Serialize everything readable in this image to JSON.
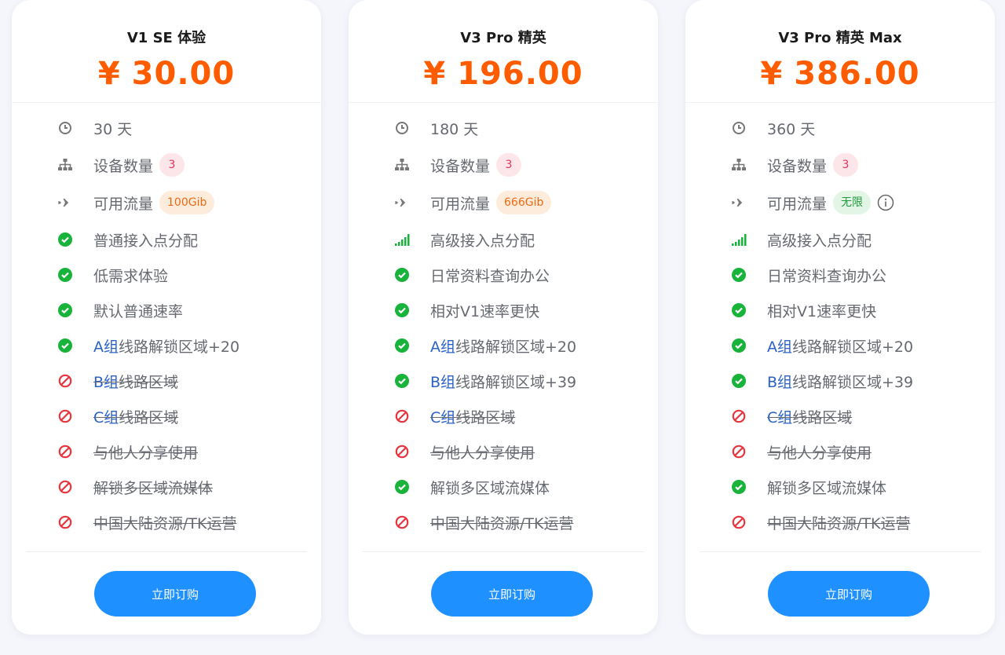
{
  "colors": {
    "accent_price": "#ff5c00",
    "button": "#1e90ff",
    "check_green": "#18b33a",
    "forbid_red": "#e8353d",
    "group_blue": "#2a62c7"
  },
  "plans": [
    {
      "name": "V1 SE 体验",
      "currency": "¥",
      "price": "30.00",
      "duration": "30 天",
      "devices_label": "设备数量",
      "devices_count": "3",
      "traffic_label": "可用流量",
      "traffic_value": "100Gib",
      "features": [
        {
          "icon": "check-circle-icon",
          "text": "普通接入点分配"
        },
        {
          "icon": "check-circle-icon",
          "text": "低需求体验"
        },
        {
          "icon": "check-circle-icon",
          "text": "默认普通速率"
        },
        {
          "icon": "check-circle-icon",
          "group": "A组",
          "text": "线路解锁区域+20"
        },
        {
          "icon": "forbidden-icon",
          "group": "B组",
          "text": "线路区域"
        },
        {
          "icon": "forbidden-icon",
          "group": "C组",
          "text": "线路区域"
        },
        {
          "icon": "forbidden-icon",
          "text": "与他人分享使用"
        },
        {
          "icon": "forbidden-icon",
          "text": "解锁多区域流媒体"
        },
        {
          "icon": "forbidden-icon",
          "text": "中国大陆资源/TK运营"
        }
      ],
      "button": "立即订购"
    },
    {
      "name": "V3 Pro 精英",
      "currency": "¥",
      "price": "196.00",
      "duration": "180 天",
      "devices_label": "设备数量",
      "devices_count": "3",
      "traffic_label": "可用流量",
      "traffic_value": "666Gib",
      "features": [
        {
          "icon": "signal-bars-icon",
          "text": "高级接入点分配"
        },
        {
          "icon": "check-circle-icon",
          "text": "日常资料查询办公"
        },
        {
          "icon": "check-circle-icon",
          "text": "相对V1速率更快"
        },
        {
          "icon": "check-circle-icon",
          "group": "A组",
          "text": "线路解锁区域+20"
        },
        {
          "icon": "check-circle-icon",
          "group": "B组",
          "text": "线路解锁区域+39"
        },
        {
          "icon": "forbidden-icon",
          "group": "C组",
          "text": "线路区域"
        },
        {
          "icon": "forbidden-icon",
          "text": "与他人分享使用"
        },
        {
          "icon": "check-circle-icon",
          "text": "解锁多区域流媒体"
        },
        {
          "icon": "forbidden-icon",
          "text": "中国大陆资源/TK运营"
        }
      ],
      "button": "立即订购"
    },
    {
      "name": "V3 Pro 精英 Max",
      "currency": "¥",
      "price": "386.00",
      "duration": "360 天",
      "devices_label": "设备数量",
      "devices_count": "3",
      "traffic_label": "可用流量",
      "traffic_value": "无限",
      "features": [
        {
          "icon": "signal-bars-icon",
          "text": "高级接入点分配"
        },
        {
          "icon": "check-circle-icon",
          "text": "日常资料查询办公"
        },
        {
          "icon": "check-circle-icon",
          "text": "相对V1速率更快"
        },
        {
          "icon": "check-circle-icon",
          "group": "A组",
          "text": "线路解锁区域+20"
        },
        {
          "icon": "check-circle-icon",
          "group": "B组",
          "text": "线路解锁区域+39"
        },
        {
          "icon": "forbidden-icon",
          "group": "C组",
          "text": "线路区域"
        },
        {
          "icon": "forbidden-icon",
          "text": "与他人分享使用"
        },
        {
          "icon": "check-circle-icon",
          "text": "解锁多区域流媒体"
        },
        {
          "icon": "forbidden-icon",
          "text": "中国大陆资源/TK运营"
        }
      ],
      "button": "立即订购"
    }
  ]
}
